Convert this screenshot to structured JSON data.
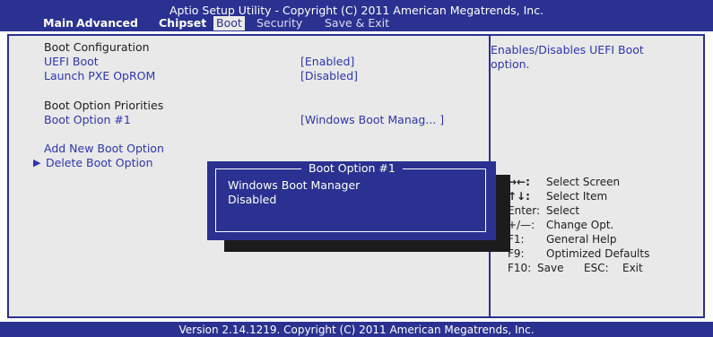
{
  "header": {
    "title": "Aptio Setup Utility - Copyright (C) 2011 American Megatrends, Inc.",
    "tabs": [
      {
        "label": "Main"
      },
      {
        "label": "Advanced"
      },
      {
        "label": "Chipset"
      },
      {
        "label": "Boot",
        "active": true
      },
      {
        "label": "Security"
      },
      {
        "label": "Save & Exit"
      }
    ]
  },
  "settings": {
    "boot_configuration_heading": "Boot Configuration",
    "uefi_boot": {
      "label": "UEFI Boot",
      "value": "[Enabled]"
    },
    "launch_pxe": {
      "label": "Launch PXE OpROM",
      "value": "[Disabled]"
    },
    "boot_priorities_heading": "Boot Option Priorities",
    "boot_option_1": {
      "label": "Boot Option #1",
      "value": "[Windows Boot Manag... ]"
    },
    "add_new_boot_option": "Add New Boot Option",
    "delete_boot_option": "Delete Boot Option",
    "submenu_arrow": "▶"
  },
  "help": {
    "line1": "Enables/Disables UEFI Boot",
    "line2": "option."
  },
  "keys": [
    {
      "key": "→←:",
      "desc": "Select Screen"
    },
    {
      "key": "↑↓:",
      "desc": "Select Item"
    },
    {
      "key": "Enter:",
      "desc": "Select"
    },
    {
      "key": "+/—:",
      "desc": "Change Opt."
    },
    {
      "key": "F1:",
      "desc": "General Help"
    },
    {
      "key": "F9:",
      "desc": "Optimized Defaults"
    },
    {
      "key": "F10:",
      "desc": "Save",
      "key2": "ESC:",
      "desc2": "Exit"
    }
  ],
  "popup": {
    "title": "Boot Option #1",
    "options": [
      "Windows Boot Manager",
      "Disabled"
    ]
  },
  "footer": {
    "text": "Version 2.14.1219. Copyright (C) 2011 American Megatrends, Inc."
  },
  "colors": {
    "bios_blue": "#2a3190",
    "panel_gray": "#e9e9e9",
    "link_blue": "#2e35b0",
    "shadow": "#1c1c1c"
  }
}
